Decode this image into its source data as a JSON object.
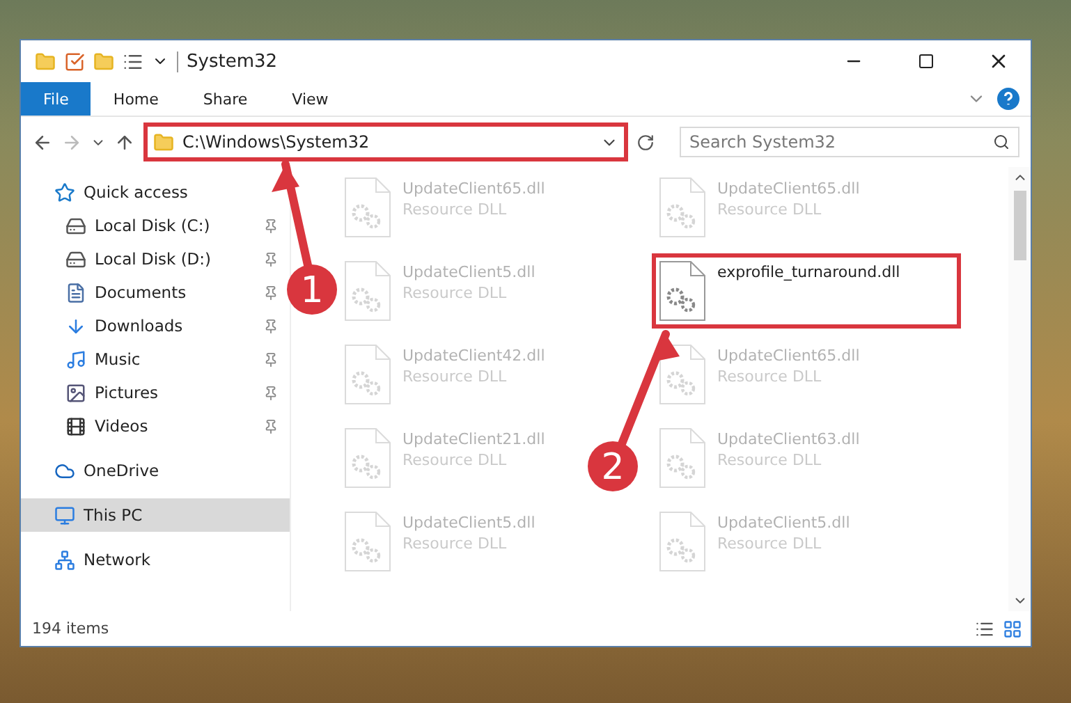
{
  "window": {
    "title": "System32"
  },
  "ribbon_tabs": [
    {
      "label": "File",
      "selected": true
    },
    {
      "label": "Home",
      "selected": false
    },
    {
      "label": "Share",
      "selected": false
    },
    {
      "label": "View",
      "selected": false
    }
  ],
  "address": {
    "path": "C:\\Windows\\System32",
    "highlighted": true
  },
  "search": {
    "placeholder": "Search System32"
  },
  "sidebar": {
    "items": [
      {
        "label": "Quick access",
        "kind": "quick",
        "selected": false,
        "children": [
          {
            "label": "Local Disk (C:)",
            "kind": "disk",
            "pinned": true,
            "selected": false
          },
          {
            "label": "Local Disk (D:)",
            "kind": "disk",
            "pinned": true,
            "selected": false
          },
          {
            "label": "Documents",
            "kind": "documents",
            "pinned": true,
            "selected": false
          },
          {
            "label": "Downloads",
            "kind": "downloads",
            "pinned": true,
            "selected": false
          },
          {
            "label": "Music",
            "kind": "music",
            "pinned": true,
            "selected": false
          },
          {
            "label": "Pictures",
            "kind": "pictures",
            "pinned": true,
            "selected": false
          },
          {
            "label": "Videos",
            "kind": "videos",
            "pinned": true,
            "selected": false
          }
        ]
      },
      {
        "label": "OneDrive",
        "kind": "cloud",
        "selected": false
      },
      {
        "label": "This PC",
        "kind": "pc",
        "selected": true
      },
      {
        "label": "Network",
        "kind": "network",
        "selected": false
      }
    ]
  },
  "files": [
    {
      "name": "UpdateClient65.dll",
      "type": "Resource DLL",
      "highlighted": false
    },
    {
      "name": "UpdateClient65.dll",
      "type": "Resource DLL",
      "highlighted": false
    },
    {
      "name": "UpdateClient5.dll",
      "type": "Resource DLL",
      "highlighted": false
    },
    {
      "name": "exprofile_turnaround.dll",
      "highlighted": true
    },
    {
      "name": "UpdateClient42.dll",
      "type": "Resource DLL",
      "highlighted": false
    },
    {
      "name": "UpdateClient65.dll",
      "type": "Resource DLL",
      "highlighted": false
    },
    {
      "name": "UpdateClient21.dll",
      "type": "Resource DLL",
      "highlighted": false
    },
    {
      "name": "UpdateClient63.dll",
      "type": "Resource DLL",
      "highlighted": false
    },
    {
      "name": "UpdateClient5.dll",
      "type": "Resource DLL",
      "highlighted": false
    },
    {
      "name": "UpdateClient5.dll",
      "type": "Resource DLL",
      "highlighted": false
    }
  ],
  "status_bar": {
    "count": "194 items"
  },
  "annotations": [
    {
      "number": "1"
    },
    {
      "number": "2"
    }
  ]
}
